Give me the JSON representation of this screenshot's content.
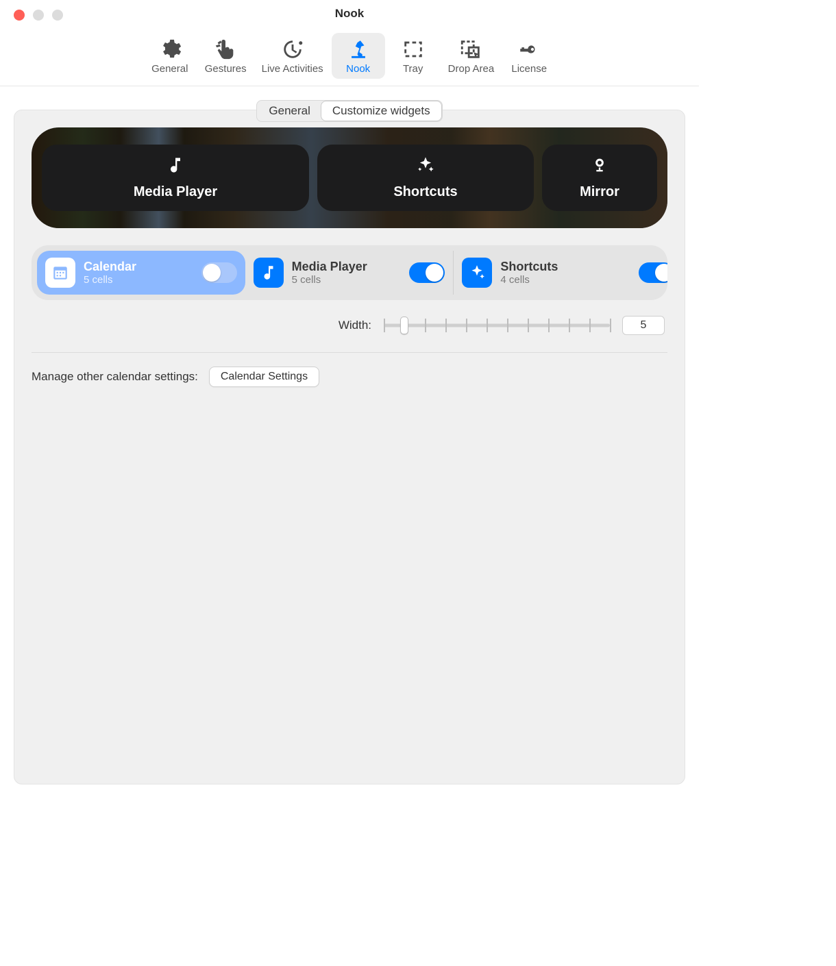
{
  "window": {
    "title": "Nook"
  },
  "toolbar": {
    "items": [
      {
        "label": "General"
      },
      {
        "label": "Gestures"
      },
      {
        "label": "Live Activities"
      },
      {
        "label": "Nook"
      },
      {
        "label": "Tray"
      },
      {
        "label": "Drop Area"
      },
      {
        "label": "License"
      }
    ],
    "active_index": 3
  },
  "subtabs": {
    "items": [
      "General",
      "Customize widgets"
    ],
    "active_index": 1
  },
  "preview": {
    "tiles": [
      {
        "label": "Media Player"
      },
      {
        "label": "Shortcuts"
      },
      {
        "label": "Mirror"
      }
    ]
  },
  "widgets": {
    "items": [
      {
        "title": "Calendar",
        "subtitle": "5 cells",
        "enabled": false,
        "selected": true
      },
      {
        "title": "Media Player",
        "subtitle": "5 cells",
        "enabled": true,
        "selected": false
      },
      {
        "title": "Shortcuts",
        "subtitle": "4 cells",
        "enabled": true,
        "selected": false
      }
    ]
  },
  "width": {
    "label": "Width:",
    "value": "5",
    "min": 1,
    "max": 12,
    "ticks": 12
  },
  "calendar_settings": {
    "label": "Manage other calendar settings:",
    "button": "Calendar Settings"
  }
}
